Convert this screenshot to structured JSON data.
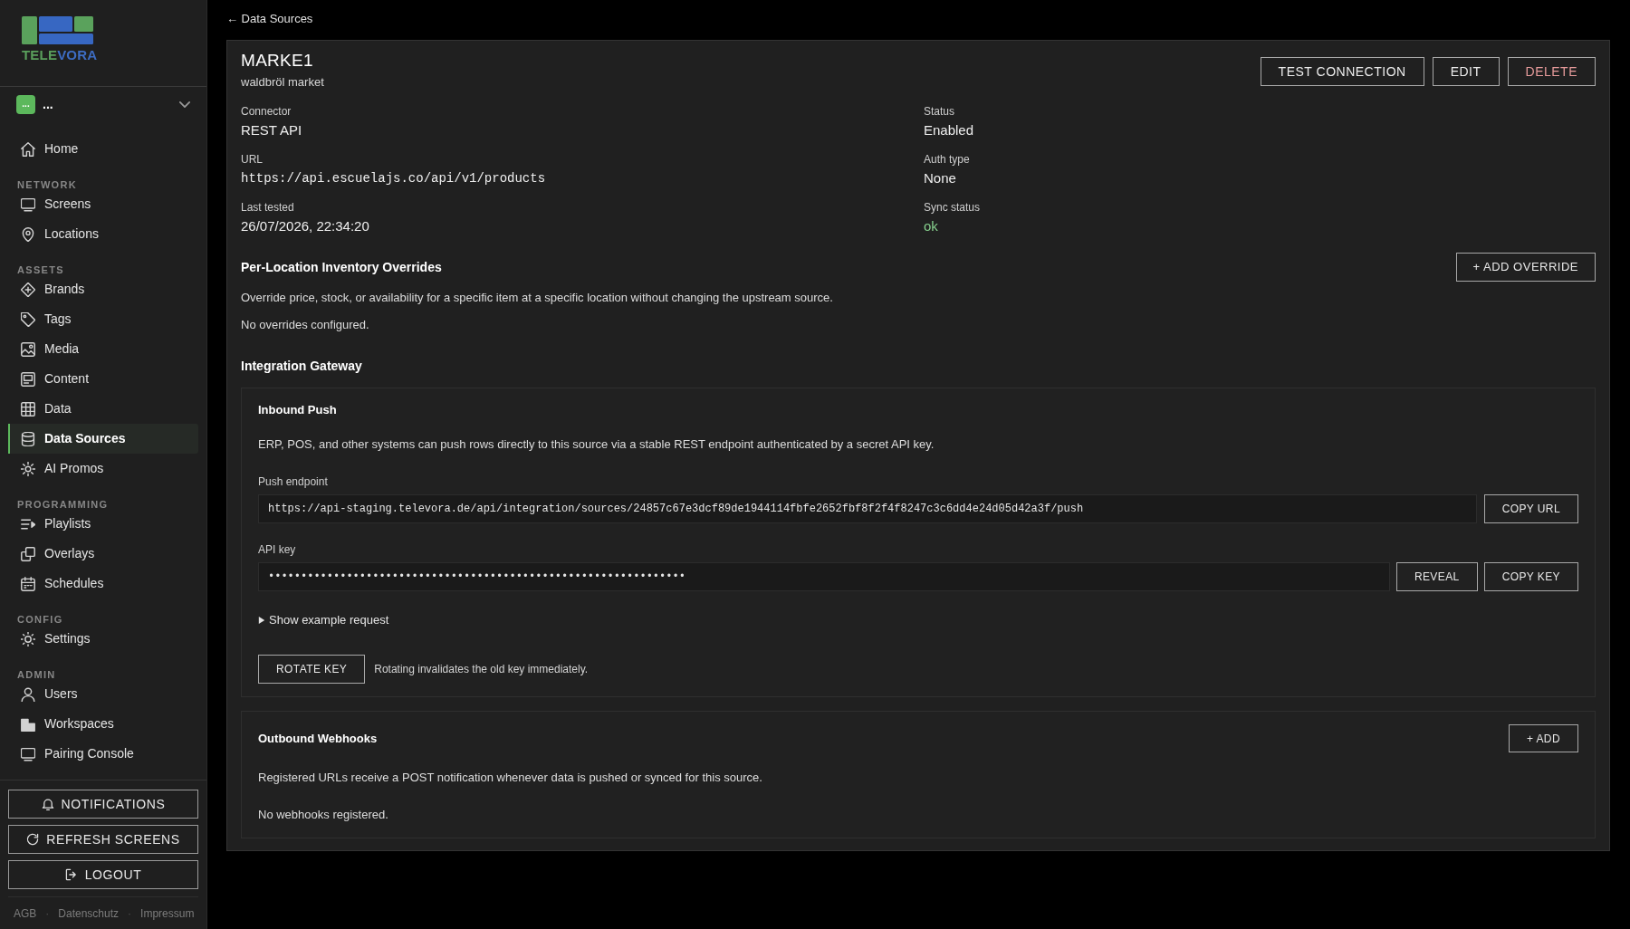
{
  "sidebar": {
    "logo": {
      "wordmark": [
        {
          "text": "TELE",
          "color": "#5a9f5c"
        },
        {
          "text": "VORA",
          "color": "#3d6cc2"
        }
      ]
    },
    "workspace": {
      "avatar": "...",
      "name": "..."
    },
    "nav": [
      {
        "kind": "link",
        "label": "Home",
        "selected": false
      },
      {
        "kind": "heading",
        "label": "NETWORK"
      },
      {
        "kind": "link",
        "label": "Screens",
        "selected": false
      },
      {
        "kind": "link",
        "label": "Locations",
        "selected": false
      },
      {
        "kind": "heading",
        "label": "ASSETS"
      },
      {
        "kind": "link",
        "label": "Brands",
        "selected": false
      },
      {
        "kind": "link",
        "label": "Tags",
        "selected": false
      },
      {
        "kind": "link",
        "label": "Media",
        "selected": false
      },
      {
        "kind": "link",
        "label": "Content",
        "selected": false
      },
      {
        "kind": "link",
        "label": "Data",
        "selected": false
      },
      {
        "kind": "link",
        "label": "Data Sources",
        "selected": true
      },
      {
        "kind": "link",
        "label": "AI Promos",
        "selected": false
      },
      {
        "kind": "heading",
        "label": "PROGRAMMING"
      },
      {
        "kind": "link",
        "label": "Playlists",
        "selected": false
      },
      {
        "kind": "link",
        "label": "Overlays",
        "selected": false
      },
      {
        "kind": "link",
        "label": "Schedules",
        "selected": false
      },
      {
        "kind": "heading",
        "label": "CONFIG"
      },
      {
        "kind": "link",
        "label": "Settings",
        "selected": false
      },
      {
        "kind": "heading",
        "label": "ADMIN"
      },
      {
        "kind": "link",
        "label": "Users",
        "selected": false
      },
      {
        "kind": "link",
        "label": "Workspaces",
        "selected": false
      },
      {
        "kind": "link",
        "label": "Pairing Console",
        "selected": false
      }
    ],
    "actions": [
      "NOTIFICATIONS",
      "REFRESH SCREENS",
      "LOGOUT"
    ],
    "footer": {
      "links": [
        "AGB",
        "Datenschutz",
        "Impressum"
      ],
      "separator": "·"
    }
  },
  "back_link": "← Data Sources",
  "source": {
    "title": "MARKE1",
    "subtitle": "waldbröl market",
    "actions": [
      {
        "label": "TEST CONNECTION",
        "kind": "default"
      },
      {
        "label": "EDIT",
        "kind": "default"
      },
      {
        "label": "DELETE",
        "kind": "danger"
      }
    ],
    "fields": [
      {
        "label": "Connector",
        "value": "REST API",
        "kind": "text"
      },
      {
        "label": "Status",
        "value": "Enabled",
        "kind": "text"
      },
      {
        "label": "URL",
        "value": "https://api.escuelajs.co/api/v1/products",
        "kind": "code"
      },
      {
        "label": "Auth type",
        "value": "None",
        "kind": "text"
      },
      {
        "label": "Last tested",
        "value": "26/07/2026, 22:34:20",
        "kind": "text"
      },
      {
        "label": "Sync status",
        "value": "ok",
        "kind": "success"
      }
    ]
  },
  "overrides": {
    "title": "Per-Location Inventory Overrides",
    "button": "+ ADD OVERRIDE",
    "description": "Override price, stock, or availability for a specific item at a specific location without changing the upstream source.",
    "empty": "No overrides configured."
  },
  "integration_gateway": {
    "title": "Integration Gateway",
    "inbound_push": {
      "title": "Inbound Push",
      "description": "ERP, POS, and other systems can push rows directly to this source via a stable REST endpoint authenticated by a secret API key.",
      "endpoint": {
        "label": "Push endpoint",
        "value": "https://api-staging.televora.de/api/integration/sources/24857c67e3dcf89de1944114fbfe2652fbf8f2f4f8247c3c6dd4e24d05d42a3f/push",
        "button": "COPY URL"
      },
      "api_key": {
        "label": "API key",
        "value": "••••••••••••••••••••••••••••••••••••••••••••••••••••••••••••••••",
        "buttons": [
          "REVEAL",
          "COPY KEY"
        ]
      },
      "example": {
        "label": "Show example request",
        "expanded": false
      },
      "rotate": {
        "button": "ROTATE KEY",
        "note": "Rotating invalidates the old key immediately."
      }
    },
    "outbound_webhooks": {
      "title": "Outbound Webhooks",
      "button": "+ ADD",
      "description": "Registered URLs receive a POST notification whenever data is pushed or synced for this source.",
      "empty": "No webhooks registered."
    }
  }
}
